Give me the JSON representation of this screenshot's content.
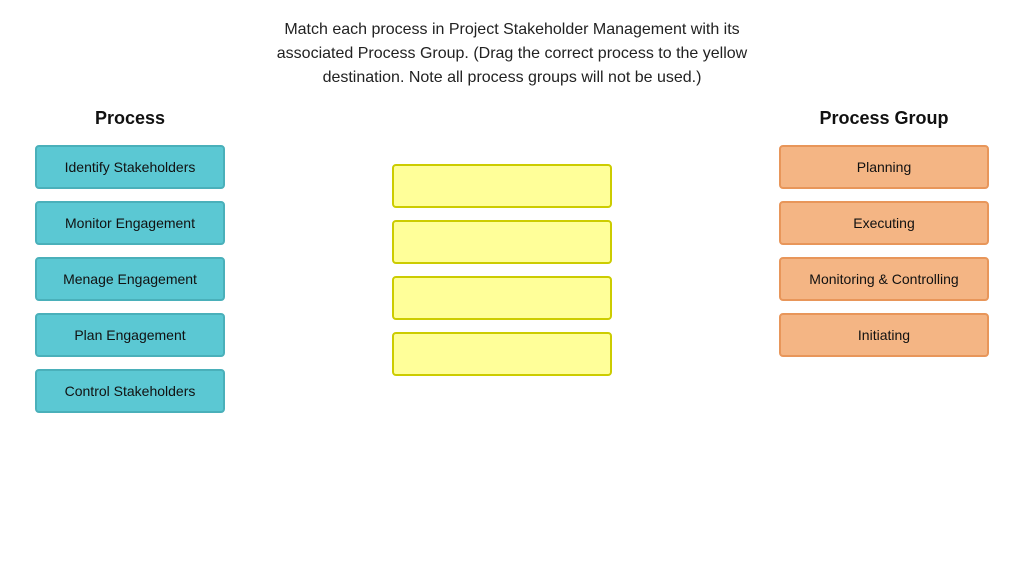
{
  "instructions": {
    "line1": "Match each process in Project Stakeholder Management with its",
    "line2": "associated Process Group. (Drag the correct process to the yellow",
    "line3": "destination.  Note all process groups will not be used.)"
  },
  "headers": {
    "process": "Process",
    "process_group": "Process Group"
  },
  "process_items": [
    {
      "id": "identify",
      "label": "Identify Stakeholders"
    },
    {
      "id": "monitor",
      "label": "Monitor Engagement"
    },
    {
      "id": "manage",
      "label": "Menage Engagement"
    },
    {
      "id": "plan",
      "label": "Plan Engagement"
    },
    {
      "id": "control",
      "label": "Control Stakeholders"
    }
  ],
  "drop_zones": [
    {
      "id": "drop1",
      "value": ""
    },
    {
      "id": "drop2",
      "value": ""
    },
    {
      "id": "drop3",
      "value": ""
    },
    {
      "id": "drop4",
      "value": ""
    }
  ],
  "group_items": [
    {
      "id": "planning",
      "label": "Planning"
    },
    {
      "id": "executing",
      "label": "Executing"
    },
    {
      "id": "monitoring",
      "label": "Monitoring & Controlling"
    },
    {
      "id": "initiating",
      "label": "Initiating"
    }
  ]
}
